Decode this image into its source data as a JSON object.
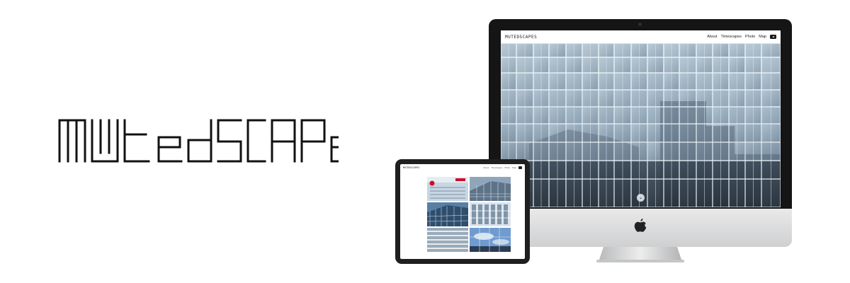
{
  "brand": {
    "wordmark": "MUTEDSCAPES"
  },
  "desktop": {
    "site_logo": "MUTEDSCAPES",
    "nav": [
      "About",
      "Timescapes",
      "Photo",
      "Map"
    ],
    "youtube_icon": "youtube-icon",
    "scroll_icon": "chevron-down-icon",
    "scroll_glyph": "⌄"
  },
  "tablet": {
    "site_logo": "MUTEDSCAPES",
    "nav": [
      "About",
      "Timescapes",
      "Photo",
      "Map"
    ],
    "youtube_icon": "youtube-icon",
    "gallery": [
      "building-facade-red-sign",
      "glass-tower-sky",
      "curved-glass-building",
      "grid-facade",
      "louvered-facade",
      "glass-facade-clouds"
    ]
  },
  "colors": {
    "background": "#ffffff",
    "bezel": "#151515",
    "chin": "#dcdcdd",
    "ipad_frame": "#1f1f21",
    "accent_red": "#c8102e"
  }
}
